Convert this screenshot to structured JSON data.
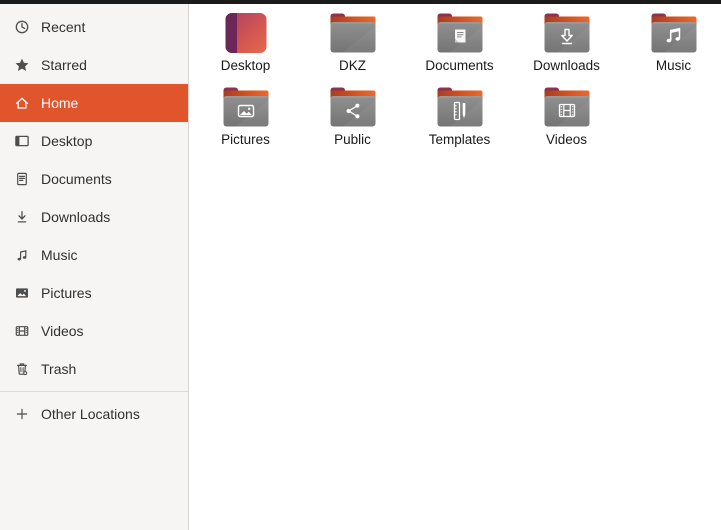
{
  "window": {
    "app": "Files",
    "topbar_color": "#1b1b1b"
  },
  "colors": {
    "accent_orange": "#e1552c",
    "sidebar_bg": "#f6f5f4",
    "sidebar_text": "#303030",
    "selected_text": "#ffffff",
    "label_text": "#191919",
    "folder_body_gray": "#858585",
    "folder_tab_maroon": "#7b2848",
    "folder_strip_orange": "#e96a2e",
    "desktop_icon_purple": "#6c2758",
    "desktop_icon_orange": "#e7694a"
  },
  "sidebar": {
    "items": [
      {
        "label": "Recent",
        "icon": "clock-icon",
        "selected": false
      },
      {
        "label": "Starred",
        "icon": "star-icon",
        "selected": false
      },
      {
        "label": "Home",
        "icon": "home-icon",
        "selected": true
      },
      {
        "label": "Desktop",
        "icon": "desktop-window-icon",
        "selected": false
      },
      {
        "label": "Documents",
        "icon": "document-icon",
        "selected": false
      },
      {
        "label": "Downloads",
        "icon": "download-arrow-icon",
        "selected": false
      },
      {
        "label": "Music",
        "icon": "music-note-icon",
        "selected": false
      },
      {
        "label": "Pictures",
        "icon": "picture-icon",
        "selected": false
      },
      {
        "label": "Videos",
        "icon": "film-icon",
        "selected": false
      },
      {
        "label": "Trash",
        "icon": "trash-icon",
        "selected": false
      }
    ],
    "footer_item": {
      "label": "Other Locations",
      "icon": "plus-icon"
    }
  },
  "main": {
    "view": "icon-grid",
    "folders": [
      {
        "name": "Desktop",
        "icon": "desktop-gradient-icon"
      },
      {
        "name": "DKZ",
        "icon": "plain-folder-icon"
      },
      {
        "name": "Documents",
        "icon": "documents-folder-icon"
      },
      {
        "name": "Downloads",
        "icon": "downloads-folder-icon"
      },
      {
        "name": "Music",
        "icon": "music-folder-icon"
      },
      {
        "name": "Pictures",
        "icon": "pictures-folder-icon"
      },
      {
        "name": "Public",
        "icon": "public-share-folder-icon"
      },
      {
        "name": "Templates",
        "icon": "templates-folder-icon"
      },
      {
        "name": "Videos",
        "icon": "videos-folder-icon"
      }
    ]
  }
}
